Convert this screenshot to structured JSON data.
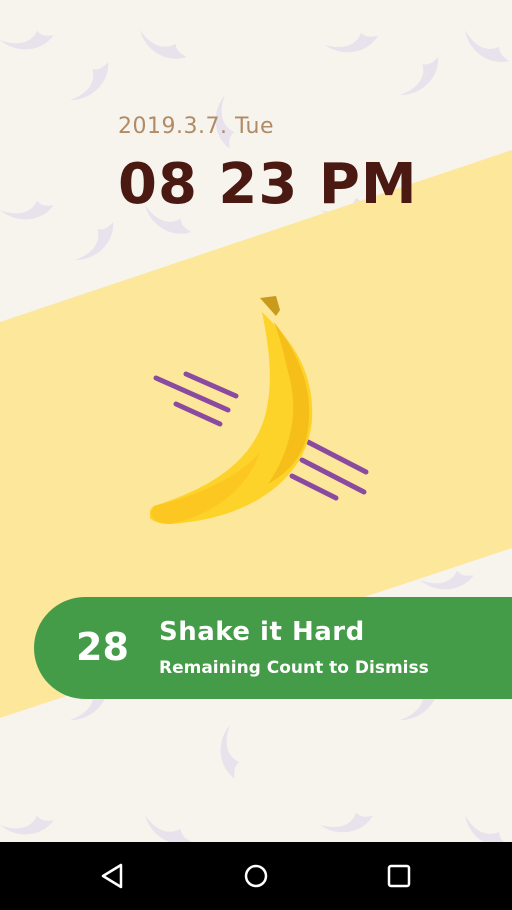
{
  "alarm": {
    "date": "2019.3.7. Tue",
    "time": "08 23 PM"
  },
  "mission": {
    "count": "28",
    "title": "Shake it Hard",
    "subtitle": "Remaining Count to Dismiss"
  },
  "icons": {
    "illustration": "banana-icon",
    "back": "back-triangle-icon",
    "home": "home-circle-icon",
    "recents": "recents-square-icon"
  },
  "colors": {
    "background": "#f7f4ee",
    "band": "#fde79a",
    "banner": "#449c48",
    "time_text": "#4a1a12",
    "date_text": "#b08b66",
    "motion_lines": "#8a4aa0",
    "banana": "#fdd32a"
  }
}
